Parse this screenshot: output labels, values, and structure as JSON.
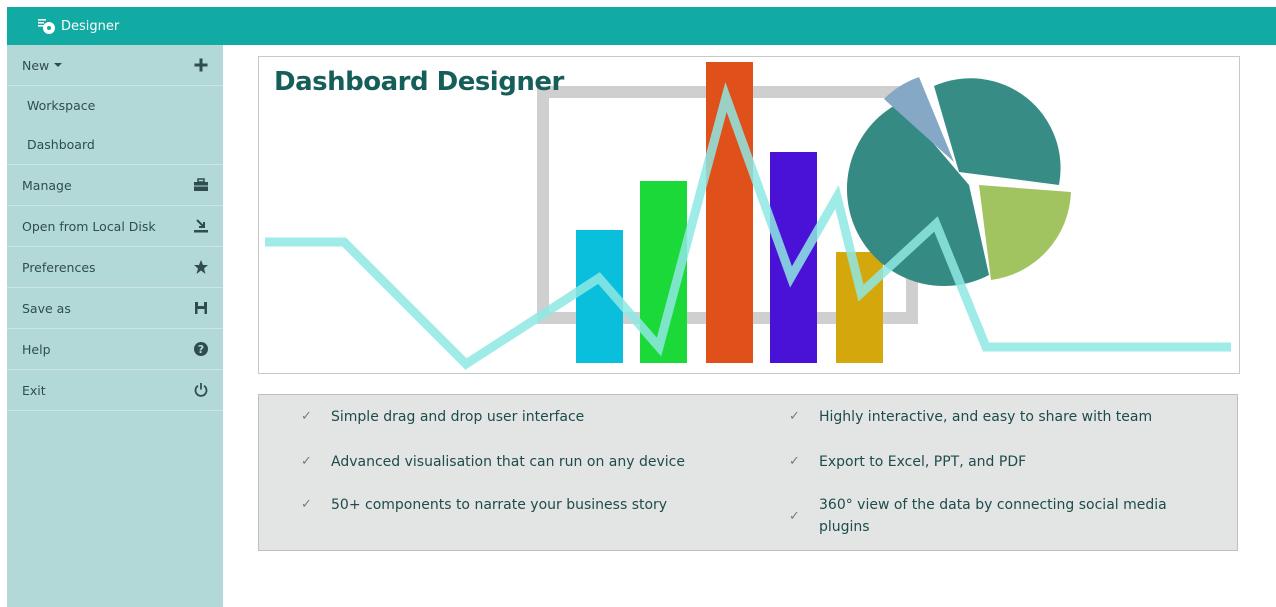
{
  "app": {
    "title": "Designer"
  },
  "sidebar": {
    "items": [
      {
        "label": "New",
        "icon": "plus-icon"
      },
      {
        "label": "Workspace"
      },
      {
        "label": "Dashboard"
      },
      {
        "label": "Manage",
        "icon": "briefcase-icon"
      },
      {
        "label": "Open from Local Disk",
        "icon": "import-icon"
      },
      {
        "label": "Preferences",
        "icon": "star-icon"
      },
      {
        "label": "Save as",
        "icon": "save-icon"
      },
      {
        "label": "Help",
        "icon": "help-icon"
      },
      {
        "label": "Exit",
        "icon": "power-icon"
      }
    ]
  },
  "banner": {
    "title": "Dashboard Designer"
  },
  "features": {
    "items": [
      "Simple drag and drop user interface",
      "Advanced visualisation that can run on any device",
      "50+ components to narrate your business story",
      "Highly interactive, and easy to share with team",
      "Export to Excel, PPT, and PDF",
      "360° view of the data by connecting social media plugins"
    ]
  },
  "colors": {
    "topbar": "#12aba4",
    "sidebar": "#b2d9d8",
    "title": "#155e5a"
  }
}
